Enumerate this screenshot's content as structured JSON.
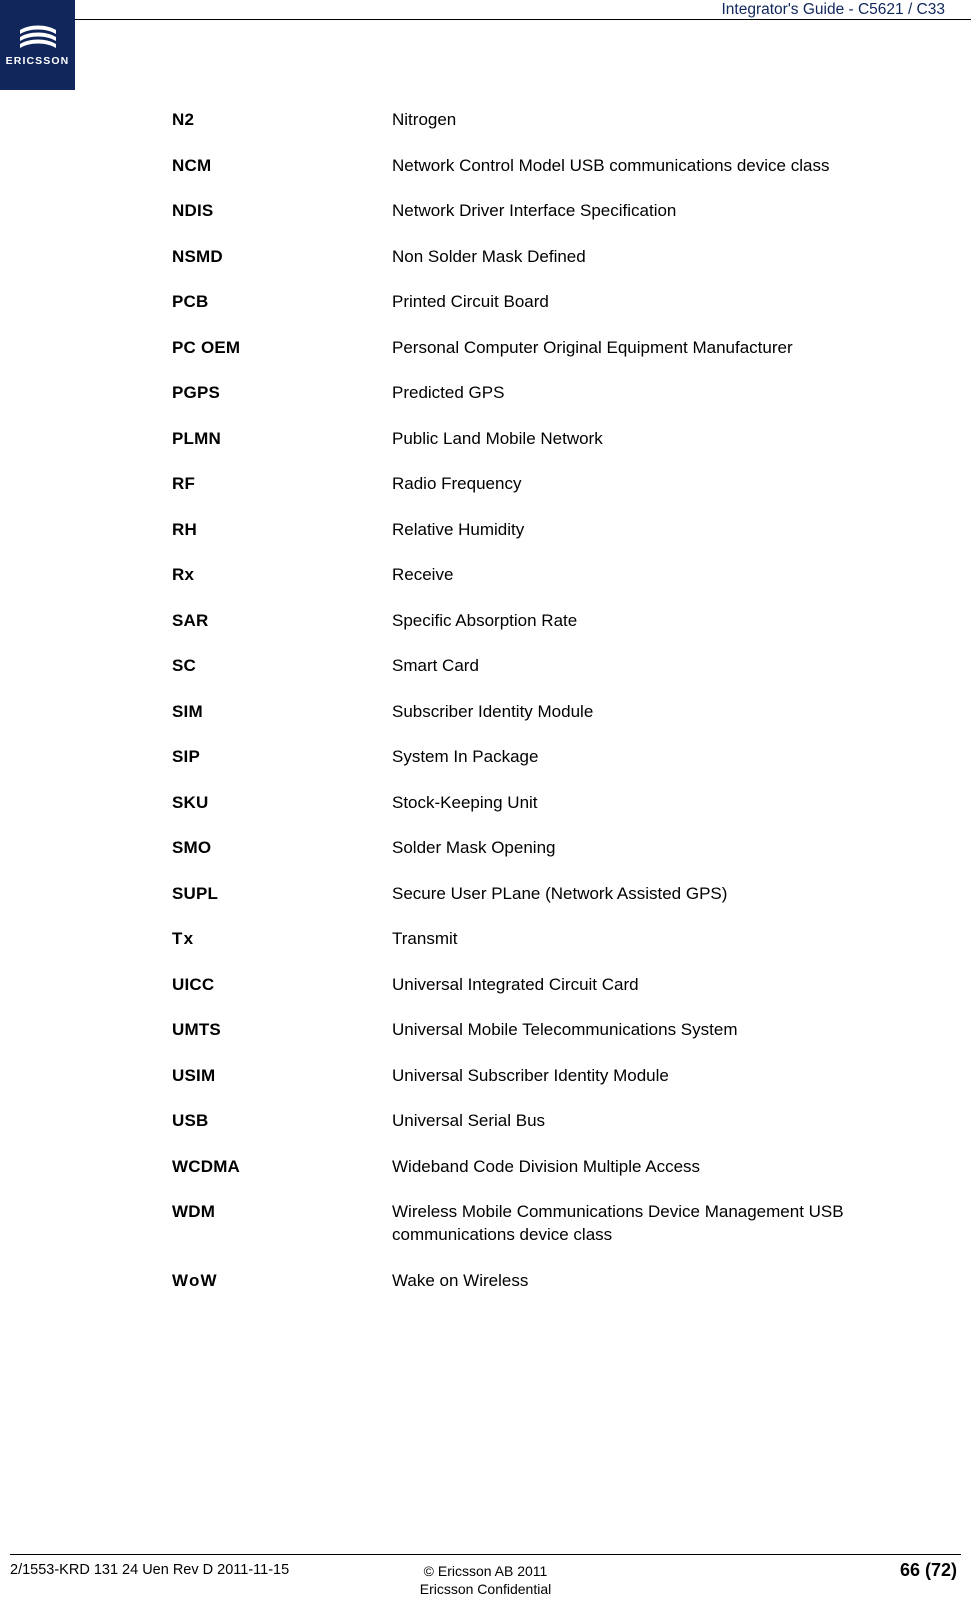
{
  "header": {
    "title": "Integrator's Guide - C5621 / C33",
    "logo_word": "ERICSSON",
    "logo_icon": "ericsson-logo-icon"
  },
  "glossary": [
    {
      "term": "N2",
      "definition": "Nitrogen"
    },
    {
      "term": "NCM",
      "definition": "Network Control Model USB communications device class"
    },
    {
      "term": "NDIS",
      "definition": "Network Driver Interface Specification"
    },
    {
      "term": "NSMD",
      "definition": "Non Solder Mask Defined"
    },
    {
      "term": "PCB",
      "definition": "Printed Circuit Board"
    },
    {
      "term": "PC OEM",
      "definition": "Personal Computer Original Equipment Manufacturer"
    },
    {
      "term": "PGPS",
      "definition": "Predicted GPS"
    },
    {
      "term": "PLMN",
      "definition": "Public Land Mobile Network"
    },
    {
      "term": "RF",
      "definition": "Radio Frequency"
    },
    {
      "term": "RH",
      "definition": "Relative Humidity"
    },
    {
      "term": "Rx",
      "definition": "Receive"
    },
    {
      "term": "SAR",
      "definition": "Specific Absorption Rate"
    },
    {
      "term": "SC",
      "definition": "Smart Card"
    },
    {
      "term": "SIM",
      "definition": "Subscriber Identity Module"
    },
    {
      "term": "SIP",
      "definition": "System In Package"
    },
    {
      "term": "SKU",
      "definition": "Stock-Keeping Unit"
    },
    {
      "term": "SMO",
      "definition": "Solder Mask Opening"
    },
    {
      "term": "SUPL",
      "definition": "Secure User PLane (Network Assisted GPS)"
    },
    {
      "term": "Tx",
      "definition": "Transmit",
      "spaced": true
    },
    {
      "term": "UICC",
      "definition": "Universal Integrated Circuit Card"
    },
    {
      "term": "UMTS",
      "definition": "Universal Mobile Telecommunications System"
    },
    {
      "term": "USIM",
      "definition": "Universal Subscriber Identity Module"
    },
    {
      "term": "USB",
      "definition": "Universal Serial Bus"
    },
    {
      "term": "WCDMA",
      "definition": "Wideband Code Division Multiple Access"
    },
    {
      "term": "WDM",
      "definition": "Wireless Mobile Communications Device Management USB communications device class"
    },
    {
      "term": "WoW",
      "definition": "Wake on Wireless",
      "spaced": true
    }
  ],
  "footer": {
    "left": "2/1553-KRD 131 24 Uen  Rev D    2011-11-15",
    "center_line1": "© Ericsson AB 2011",
    "center_line2": "Ericsson Confidential",
    "page": "66 (72)"
  }
}
